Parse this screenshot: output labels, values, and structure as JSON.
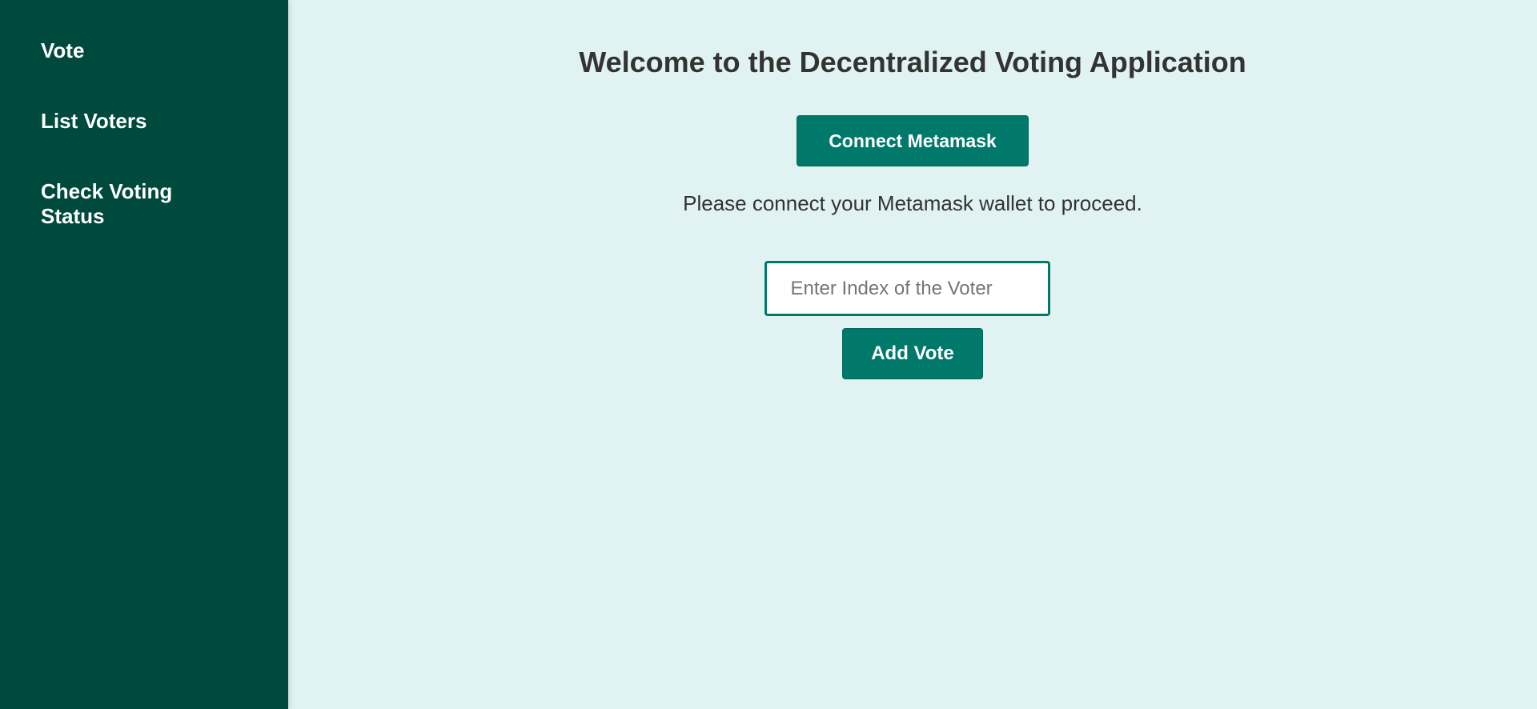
{
  "theme": {
    "sidebar_bg": "#004a3d",
    "main_bg": "#e0f2f1",
    "accent": "#00796b",
    "text": "#333333"
  },
  "sidebar": {
    "items": [
      {
        "label": "Vote"
      },
      {
        "label": "List Voters"
      },
      {
        "label": "Check Voting Status"
      }
    ]
  },
  "main": {
    "title": "Welcome to the Decentralized Voting Application",
    "connect_button_label": "Connect Metamask",
    "message": "Please connect your Metamask wallet to proceed.",
    "voter_index_input": {
      "value": "",
      "placeholder": "Enter Index of the Voter"
    },
    "add_vote_button_label": "Add Vote"
  }
}
